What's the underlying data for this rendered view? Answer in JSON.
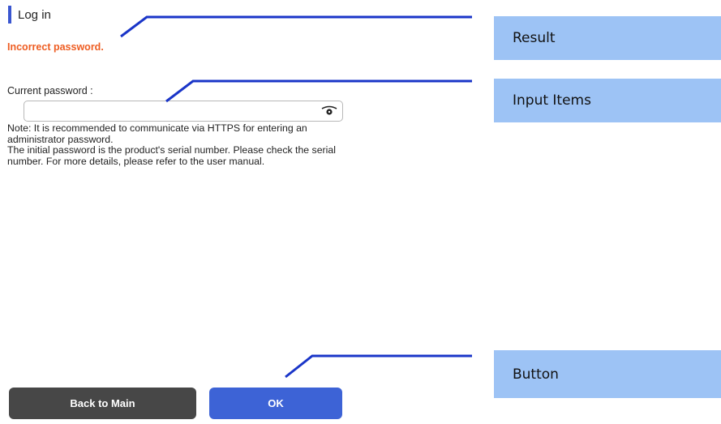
{
  "page": {
    "title": "Log in",
    "error_message": "Incorrect password."
  },
  "form": {
    "password_label": "Current password :",
    "password_value": "",
    "password_placeholder": "",
    "show_password_icon": "eye-icon"
  },
  "note": {
    "line1": "Note: It is recommended to communicate via HTTPS for entering an administrator password.",
    "line2": "The initial password is the product's serial number. Please check the serial number. For more details, please refer to the user manual."
  },
  "buttons": {
    "back": "Back to Main",
    "ok": "OK"
  },
  "callouts": {
    "result": "Result",
    "input_items": "Input Items",
    "button": "Button"
  },
  "colors": {
    "title_accent": "#3a56d0",
    "error": "#ee5d22",
    "back_button": "#474747",
    "ok_button": "#3d63d6",
    "callout_bg": "#9dc3f5",
    "leader_line": "#1a35c8"
  }
}
